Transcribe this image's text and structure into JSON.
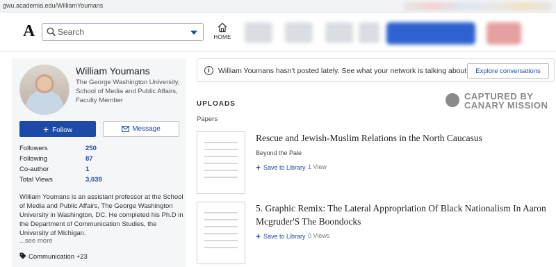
{
  "browser": {
    "url": "gwu.academia.edu/WilliamYoumans"
  },
  "header": {
    "logo": "A",
    "search_placeholder": "Search",
    "home_label": "HOME"
  },
  "profile": {
    "name": "William Youmans",
    "affiliation": "The George Washington University, School of Media and Public Affairs, Faculty Member",
    "follow_label": "Follow",
    "message_label": "Message",
    "stats": [
      {
        "label": "Followers",
        "value": "250"
      },
      {
        "label": "Following",
        "value": "87"
      },
      {
        "label": "Co-author",
        "value": "1"
      },
      {
        "label": "Total Views",
        "value": "3,039"
      }
    ],
    "bio": "William Youmans is an assistant professor at the School of Media and Public Affairs, The George Washington University in Washington, DC.  He completed his Ph.D in the Department of Communication Studies, the University of Michigan.",
    "see_more": "...see more",
    "tag": "Communication +23"
  },
  "notice": {
    "text": "William Youmans hasn't posted lately. See what your network is talking about.",
    "button": "Explore conversations"
  },
  "uploads": {
    "heading": "UPLOADS",
    "section": "Papers",
    "items": [
      {
        "title": "Rescue and Jewish-Muslim Relations in the North Caucasus",
        "subtitle": "Beyond the Pale",
        "save_label": "Save to Library",
        "views": "1 View"
      },
      {
        "title": "5. Graphic Remix: The Lateral Appropriation Of Black Nationalism In Aaron Mcgruder'S The Boondocks",
        "subtitle": "",
        "save_label": "Save to Library",
        "views": "0 Views"
      }
    ]
  },
  "watermark": {
    "line1": "CAPTURED BY",
    "line2": "CANARY MISSION"
  },
  "colors": {
    "primary": "#1c4aa6",
    "panel": "#f5f6f8"
  }
}
